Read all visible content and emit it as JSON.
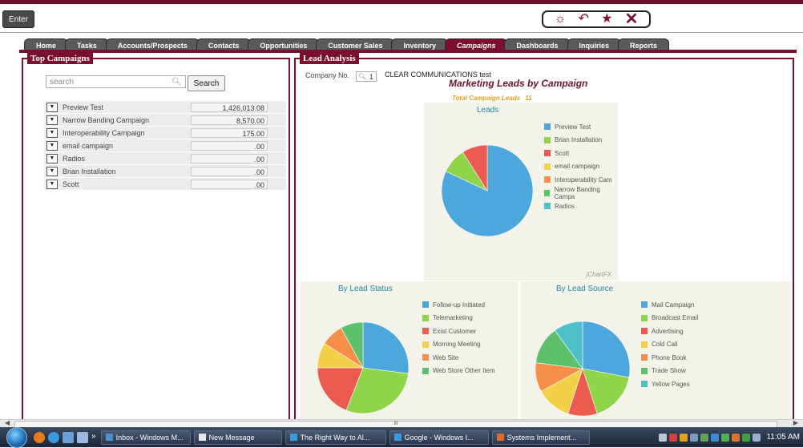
{
  "header": {
    "enter_label": "Enter",
    "toolbar_icons": [
      "sun-icon",
      "back-arrow-icon",
      "star-icon",
      "close-icon"
    ]
  },
  "tabs": [
    {
      "label": "Home",
      "active": false
    },
    {
      "label": "Tasks",
      "active": false
    },
    {
      "label": "Accounts/Prospects",
      "active": false
    },
    {
      "label": "Contacts",
      "active": false
    },
    {
      "label": "Opportunities",
      "active": false
    },
    {
      "label": "Customer Sales",
      "active": false
    },
    {
      "label": "Inventory",
      "active": false
    },
    {
      "label": "Campaigns",
      "active": true
    },
    {
      "label": "Dashboards",
      "active": false
    },
    {
      "label": "Inquiries",
      "active": false
    },
    {
      "label": "Reports",
      "active": false
    }
  ],
  "top_campaigns": {
    "title": "Top Campaigns",
    "search_placeholder": "search",
    "search_button": "Search",
    "rows": [
      {
        "name": "Preview Test",
        "value": "1,426,013.08"
      },
      {
        "name": "Narrow Banding Campaign",
        "value": "8,570.00"
      },
      {
        "name": "Interoperability Campaign",
        "value": "175.00"
      },
      {
        "name": "email campaign",
        "value": ".00"
      },
      {
        "name": "Radios",
        "value": ".00"
      },
      {
        "name": "Brian Installation",
        "value": ".00"
      },
      {
        "name": "Scott",
        "value": ".00"
      }
    ]
  },
  "lead_analysis": {
    "title": "Lead Analysis",
    "company_label": "Company No.",
    "company_no": "1",
    "company_name": "CLEAR COMMUNICATIONS test",
    "report_title": "Marketing Leads by Campaign",
    "total_label": "Total Campaign Leads",
    "total_value": "11",
    "watermark": "jChartFX"
  },
  "colors": {
    "accent": "#7a0f30",
    "blue": "#4ea7dc",
    "green": "#8fd449",
    "red": "#ec5b4f",
    "yellow": "#f4cf48",
    "orange": "#f58f4a",
    "dgreen": "#5ec06a",
    "teal": "#4ec0c9"
  },
  "chart_data": [
    {
      "type": "pie",
      "title": "Leads",
      "categories": [
        "Preview Test",
        "Brian Installation",
        "Scott",
        "email campaign",
        "Interoperability Cam",
        "Narrow Banding Campa",
        "Radios"
      ],
      "values": [
        82,
        9,
        9,
        0,
        0,
        0,
        0
      ],
      "colors": [
        "#4ea7dc",
        "#8fd449",
        "#ec5b4f",
        "#f4cf48",
        "#f58f4a",
        "#5ec06a",
        "#4ec0c9"
      ],
      "legend": "right"
    },
    {
      "type": "pie",
      "title": "By Lead Status",
      "categories": [
        "Follow-up Initiated",
        "Telemarketing",
        "Exist Customer",
        "Morning Meeting",
        "Web Site",
        "Web Store Other Item"
      ],
      "values": [
        27,
        29,
        19,
        9,
        8,
        8
      ],
      "colors": [
        "#4ea7dc",
        "#8fd449",
        "#ec5b4f",
        "#f4cf48",
        "#f58f4a",
        "#5ec06a"
      ],
      "legend": "right"
    },
    {
      "type": "pie",
      "title": "By Lead Source",
      "categories": [
        "Mail Campaign",
        "Broadcast Email",
        "Advertising",
        "Cold Call",
        "Phone Book",
        "Trade Show",
        "Yellow Pages"
      ],
      "values": [
        28,
        17,
        10,
        12,
        10,
        13,
        10
      ],
      "colors": [
        "#4ea7dc",
        "#8fd449",
        "#ec5b4f",
        "#f4cf48",
        "#f58f4a",
        "#5ec06a",
        "#4ec0c9"
      ],
      "legend": "right"
    }
  ],
  "scrollbar_text": "III",
  "taskbar": {
    "items": [
      {
        "label": "Inbox - Windows M...",
        "color": "#4a90d0"
      },
      {
        "label": "New Message",
        "color": "#e8e8e8"
      },
      {
        "label": "The Right Way to Al...",
        "color": "#3a9ae0"
      },
      {
        "label": "Google - Windows I...",
        "color": "#3a9ae0"
      },
      {
        "label": "Systems Implement...",
        "color": "#e06a2a"
      }
    ],
    "clock": "11:05 AM",
    "chevron": "»"
  }
}
